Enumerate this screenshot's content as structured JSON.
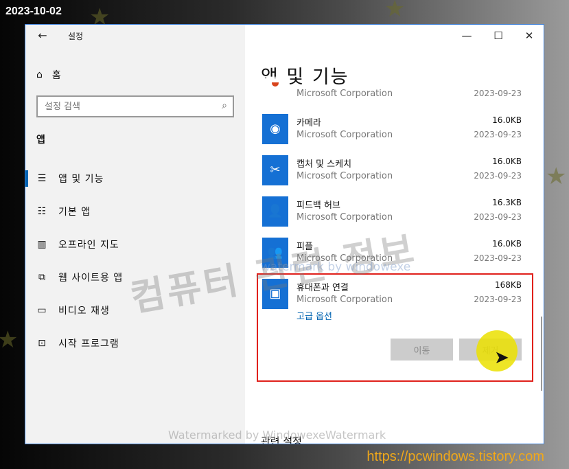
{
  "overlay": {
    "date_stamp": "2023-10-02",
    "site_url": "https://pcwindows.tistory.com",
    "watermark_big": "컴퓨터 관련 정보",
    "watermark_small": "watermark by windowexe",
    "watermark_bottom": "Watermarked by WindowexeWatermark"
  },
  "window": {
    "title": "설정",
    "back_icon": "back-arrow-icon",
    "controls": {
      "minimize": "—",
      "maximize": "☐",
      "close": "✕"
    }
  },
  "sidebar": {
    "home_label": "홈",
    "search_placeholder": "설정 검색",
    "section_label": "앱",
    "items": [
      {
        "label": "앱 및 기능",
        "icon": "apps-features-icon",
        "glyph": "☰",
        "active": true
      },
      {
        "label": "기본 앱",
        "icon": "default-apps-icon",
        "glyph": "☷",
        "active": false
      },
      {
        "label": "오프라인 지도",
        "icon": "offline-maps-icon",
        "glyph": "▥",
        "active": false
      },
      {
        "label": "웹 사이트용 앱",
        "icon": "apps-for-websites-icon",
        "glyph": "⧉",
        "active": false
      },
      {
        "label": "비디오 재생",
        "icon": "video-playback-icon",
        "glyph": "▭",
        "active": false
      },
      {
        "label": "시작 프로그램",
        "icon": "startup-icon",
        "glyph": "⊡",
        "active": false
      }
    ]
  },
  "main": {
    "heading": "앱 및 기능",
    "apps": [
      {
        "name": "",
        "publisher": "Microsoft Corporation",
        "size": "",
        "date": "2023-09-23"
      },
      {
        "name": "카메라",
        "publisher": "Microsoft Corporation",
        "size": "16.0KB",
        "date": "2023-09-23"
      },
      {
        "name": "캡처 및 스케치",
        "publisher": "Microsoft Corporation",
        "size": "16.0KB",
        "date": "2023-09-23"
      },
      {
        "name": "피드백 허브",
        "publisher": "Microsoft Corporation",
        "size": "16.3KB",
        "date": "2023-09-23"
      },
      {
        "name": "피플",
        "publisher": "Microsoft Corporation",
        "size": "16.0KB",
        "date": "2023-09-23"
      },
      {
        "name": "휴대폰과 연결",
        "publisher": "Microsoft Corporation",
        "size": "168KB",
        "date": "2023-09-23",
        "link": "고급 옵션"
      }
    ],
    "move_button": "이동",
    "uninstall_button": "제거",
    "related_settings": "관련 설정"
  },
  "colors": {
    "accent": "#0063b1",
    "highlight": "#e0201b",
    "cursor": "#ebe100"
  }
}
